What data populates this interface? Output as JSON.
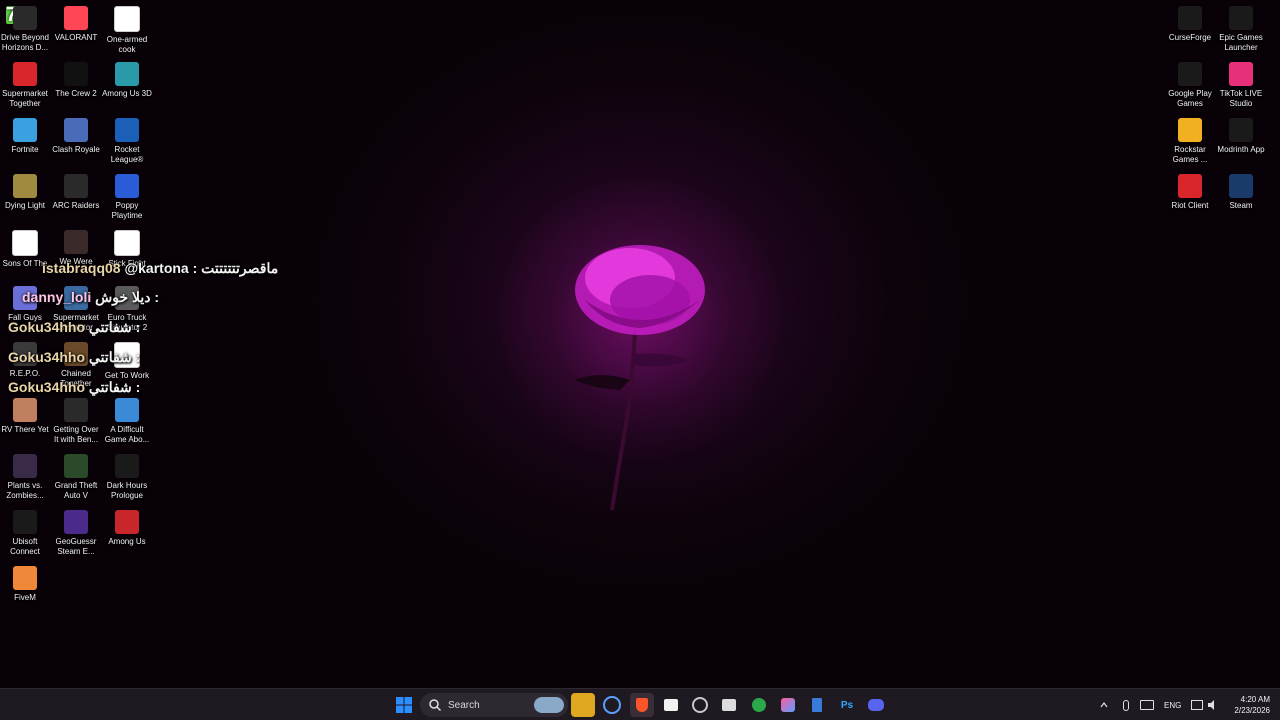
{
  "overlay": {
    "counter": "76"
  },
  "desktop_icons_left": [
    {
      "label": "Drive Beyond Horizons D...",
      "icon": "drive-beyond-horizons-icon",
      "color": "#2a2a2a"
    },
    {
      "label": "VALORANT",
      "icon": "valorant-icon",
      "color": "#ff4655"
    },
    {
      "label": "One-armed cook",
      "icon": "file-icon",
      "color": "#ffffff"
    },
    {
      "label": "Supermarket Together",
      "icon": "supermarket-together-icon",
      "color": "#d8262b"
    },
    {
      "label": "The Crew 2",
      "icon": "the-crew-2-icon",
      "color": "#111111"
    },
    {
      "label": "Among Us 3D",
      "icon": "among-us-3d-icon",
      "color": "#2b9aa8"
    },
    {
      "label": "Fortnite",
      "icon": "fortnite-icon",
      "color": "#3aa0e0"
    },
    {
      "label": "Clash Royale",
      "icon": "clash-royale-icon",
      "color": "#4a6bb8"
    },
    {
      "label": "Rocket League®",
      "icon": "rocket-league-icon",
      "color": "#1a5fb8"
    },
    {
      "label": "Dying Light",
      "icon": "dying-light-icon",
      "color": "#a08a40"
    },
    {
      "label": "ARC Raiders",
      "icon": "arc-raiders-icon",
      "color": "#2a2a2a"
    },
    {
      "label": "Poppy Playtime",
      "icon": "poppy-playtime-icon",
      "color": "#2a5cd8"
    },
    {
      "label": "Sons Of The",
      "icon": "file-icon",
      "color": "#ffffff"
    },
    {
      "label": "We Were",
      "icon": "we-were-here-icon",
      "color": "#3a2a2a"
    },
    {
      "label": "Stick Fight",
      "icon": "file-icon",
      "color": "#ffffff"
    },
    {
      "label": "Fall Guys",
      "icon": "fall-guys-icon",
      "color": "#6a70d8"
    },
    {
      "label": "Supermarket Simulator",
      "icon": "supermarket-simulator-icon",
      "color": "#3a6aa0"
    },
    {
      "label": "Euro Truck Simulator 2",
      "icon": "euro-truck-simulator-icon",
      "color": "#5a5a5a"
    },
    {
      "label": "R.E.P.O.",
      "icon": "repo-icon",
      "color": "#3a3a3a"
    },
    {
      "label": "Chained Together",
      "icon": "chained-together-icon",
      "color": "#6a4a2a"
    },
    {
      "label": "Get To Work",
      "icon": "file-icon",
      "color": "#ffffff"
    },
    {
      "label": "RV There Yet",
      "icon": "rv-there-yet-icon",
      "color": "#c08060"
    },
    {
      "label": "Getting Over It with Ben...",
      "icon": "getting-over-it-icon",
      "color": "#2a2a2a"
    },
    {
      "label": "A Difficult Game Abo...",
      "icon": "difficult-game-icon",
      "color": "#3a8ad8"
    },
    {
      "label": "Plants vs. Zombies...",
      "icon": "plants-vs-zombies-icon",
      "color": "#3a2a4a"
    },
    {
      "label": "Grand Theft Auto V",
      "icon": "gta-v-icon",
      "color": "#2a4a2a"
    },
    {
      "label": "Dark Hours Prologue",
      "icon": "dark-hours-icon",
      "color": "#1a1a1a"
    },
    {
      "label": "Ubisoft Connect",
      "icon": "ubisoft-connect-icon",
      "color": "#1a1a1a"
    },
    {
      "label": "GeoGuessr Steam E...",
      "icon": "geoguessr-icon",
      "color": "#4a2a8a"
    },
    {
      "label": "Among Us",
      "icon": "among-us-icon",
      "color": "#c8262b"
    },
    {
      "label": "FiveM",
      "icon": "fivem-icon",
      "color": "#f0883a"
    }
  ],
  "desktop_icons_right": [
    {
      "label": "CurseForge",
      "icon": "curseforge-icon",
      "color": "#1a1a1a"
    },
    {
      "label": "Epic Games Launcher",
      "icon": "epic-games-icon",
      "color": "#1a1a1a"
    },
    {
      "label": "Google Play Games",
      "icon": "google-play-games-icon",
      "color": "#1a1a1a"
    },
    {
      "label": "TikTok LIVE Studio",
      "icon": "tiktok-live-studio-icon",
      "color": "#e8307a"
    },
    {
      "label": "Rockstar Games ...",
      "icon": "rockstar-games-icon",
      "color": "#f0b020"
    },
    {
      "label": "Modrinth App",
      "icon": "modrinth-icon",
      "color": "#1a1a1a"
    },
    {
      "label": "Riot Client",
      "icon": "riot-client-icon",
      "color": "#d8262b"
    },
    {
      "label": "Steam",
      "icon": "steam-icon",
      "color": "#1a3a6a"
    }
  ],
  "chat": [
    {
      "user": "istabraqq08",
      "message": "@kartona : ماقصرتتتتتتت",
      "pink": false
    },
    {
      "user": "danny_loli",
      "message": "ديلا خوش : ",
      "pink": true
    },
    {
      "user": "Goku34hho",
      "message": "شفاتتي : ",
      "pink": false
    },
    {
      "user": "Goku34hho",
      "message": "شفاتتي : ",
      "pink": false
    },
    {
      "user": "Goku34hho",
      "message": "شفاتتي : ",
      "pink": false
    }
  ],
  "taskbar": {
    "search_label": "Search",
    "language": "ENG",
    "time": "4:20 AM",
    "date": "2/23/2026",
    "accent": "#2b8fff"
  }
}
